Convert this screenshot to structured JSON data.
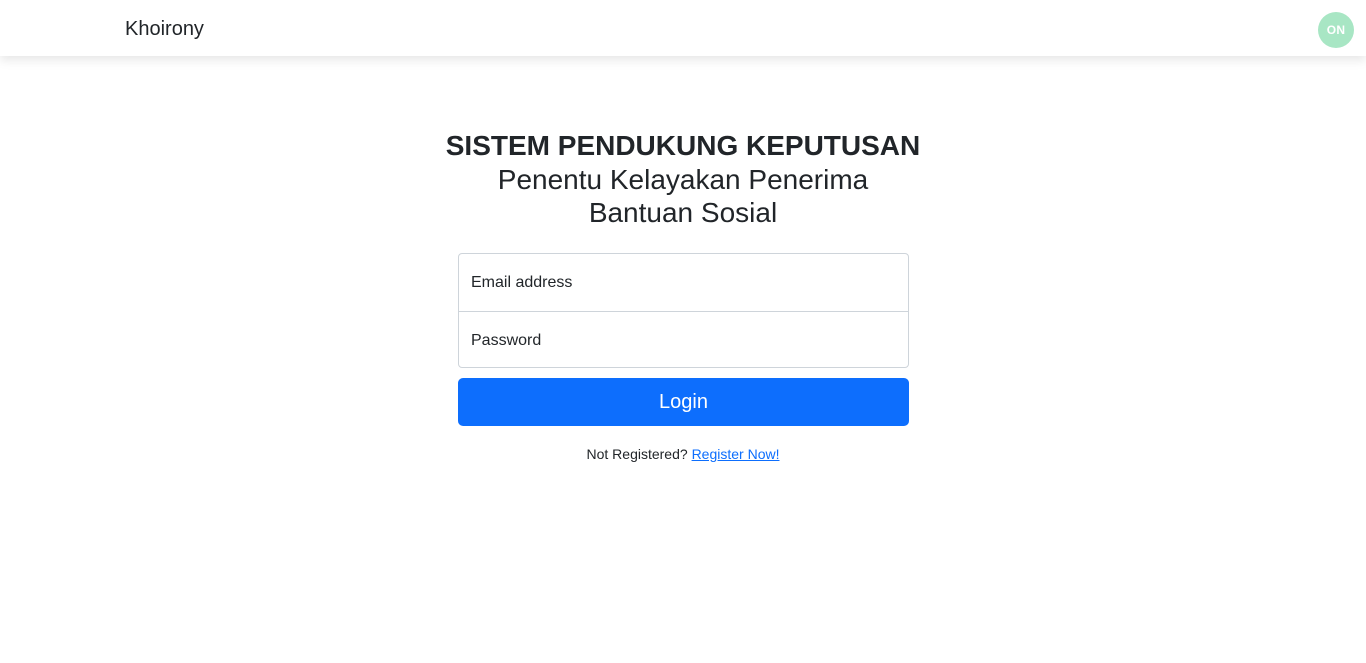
{
  "navbar": {
    "brand": "Khoirony",
    "avatar_initials": "ON",
    "avatar_color": "#a8e6c4"
  },
  "heading": {
    "title": "SISTEM PENDUKUNG KEPUTUSAN",
    "subtitle": "Penentu Kelayakan Penerima Bantuan Sosial"
  },
  "form": {
    "email_placeholder": "Email address",
    "email_value": "",
    "password_placeholder": "Password",
    "password_value": "",
    "login_label": "Login",
    "button_color": "#0d6efd"
  },
  "register": {
    "prompt": "Not Registered?",
    "link_label": "Register Now!"
  }
}
